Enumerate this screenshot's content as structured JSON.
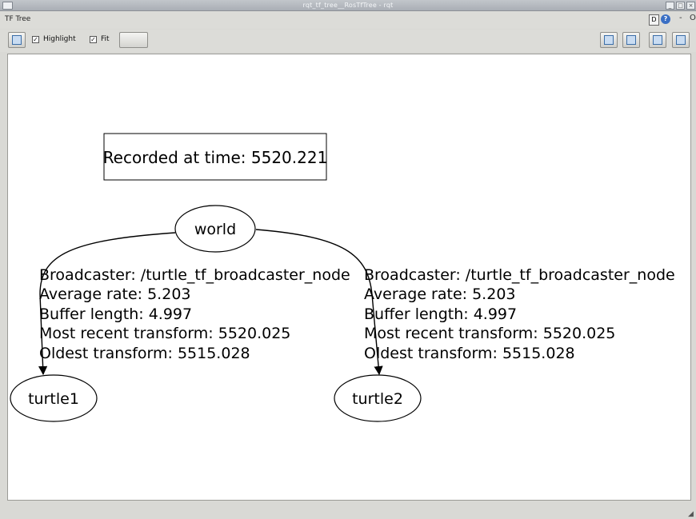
{
  "window": {
    "title": "rqt_tf_tree__RosTfTree - rqt"
  },
  "panel": {
    "title": "TF Tree",
    "d_label": "D",
    "help_glyph": "?",
    "minus_glyph": "-",
    "close_glyph": "O"
  },
  "toolbar": {
    "refresh_icon": "refresh-graph-icon",
    "highlight_label": "Highlight",
    "highlight_checked": true,
    "fit_label": "Fit",
    "fit_checked": true,
    "right_icons": [
      "open-icon",
      "save-dot-icon",
      "save-svg-icon",
      "save-image-icon"
    ]
  },
  "graph": {
    "recorded_label": "Recorded at time: 5520.221",
    "nodes": {
      "world": "world",
      "turtle1": "turtle1",
      "turtle2": "turtle2"
    },
    "edges": [
      {
        "from": "world",
        "to": "turtle1",
        "broadcaster": "Broadcaster: /turtle_tf_broadcaster_node",
        "average_rate": "Average rate: 5.203",
        "buffer_length": "Buffer length: 4.997",
        "most_recent": "Most recent transform: 5520.025",
        "oldest": "Oldest transform: 5515.028"
      },
      {
        "from": "world",
        "to": "turtle2",
        "broadcaster": "Broadcaster: /turtle_tf_broadcaster_node",
        "average_rate": "Average rate: 5.203",
        "buffer_length": "Buffer length: 4.997",
        "most_recent": "Most recent transform: 5520.025",
        "oldest": "Oldest transform: 5515.028"
      }
    ]
  }
}
